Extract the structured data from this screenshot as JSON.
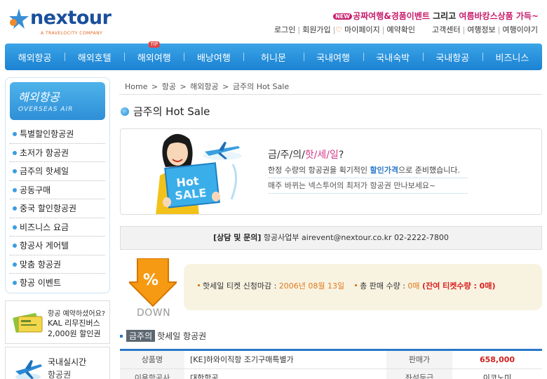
{
  "header": {
    "logo_text": "nextour",
    "logo_sub": "A TRAVELOCITY COMPANY",
    "promo_new": "NEW",
    "promo_1": "공짜여행&경품이벤트",
    "promo_mid": "그리고",
    "promo_2": "여름바캉스상품 가득~",
    "links_left": [
      "로그인",
      "회원가입",
      "마이페이지",
      "예약확인"
    ],
    "links_right": [
      "고객센터",
      "여행정보",
      "여행이야기"
    ]
  },
  "nav": {
    "items": [
      "해외항공",
      "해외호텔",
      "해외여행",
      "배낭여행",
      "허니문",
      "국내여행",
      "국내숙박",
      "국내항공",
      "비즈니스"
    ],
    "badge": "TIP"
  },
  "sidebar": {
    "title_ko": "해외항공",
    "title_en": "OVERSEAS AIR",
    "menu": [
      "특별할인항공권",
      "초저가 항공권",
      "금주의 핫세일",
      "공동구매",
      "중국 할인항공권",
      "비즈니스 요금",
      "항공사 게어텔",
      "맞춤 항공권",
      "항공 이벤트"
    ],
    "ad1": {
      "line1": "항공 예약하셨어요?",
      "line2": "KAL 리무진버스",
      "line3": "2,000원 할인권"
    },
    "ad2": {
      "line1": "국내실시간",
      "line2": "항공권"
    }
  },
  "breadcrumb": [
    "Home",
    "항공",
    "해외항공",
    "금주의 Hot Sale"
  ],
  "breadcrumb_sep": ">",
  "page_title": "금주의 Hot Sale",
  "banner": {
    "sign_line1": "Hot",
    "sign_line2": "SALE",
    "title_a": "금/주/의/",
    "title_b": "핫/세/일",
    "title_c": "?",
    "line1_a": "한정 수량의 항공권을 획기적인 ",
    "line1_b": "할인가격",
    "line1_c": "으로 준비했습니다.",
    "line2": "매주 바뀌는 넥스투어의 최저가 항공권 만나보세요~"
  },
  "contact": {
    "label": "[상담 및 문의]",
    "text": "항공사업부 airevent@nextour.co.kr 02-2222-7800"
  },
  "down": {
    "symbol": "%",
    "label": "DOWN"
  },
  "saleinfo": {
    "deadline_label": "핫세일 티켓 신청마감 :",
    "deadline_value": "2006년 08월 13일",
    "qty_label": "총 판매 수량 :",
    "qty_value": "0매",
    "remain": "(잔여 티켓수량 : 0매)"
  },
  "section": {
    "tag": "금주의",
    "title": "핫세일 항공권"
  },
  "table": {
    "rows": [
      {
        "label": "상품명",
        "value": "[KE]하와이직항 조기구매특별가",
        "label2": "판매가",
        "value2": "658,000"
      },
      {
        "label": "이용항공사",
        "value": "대한항공",
        "label2": "좌석등급",
        "value2": "이코노미"
      }
    ]
  }
}
